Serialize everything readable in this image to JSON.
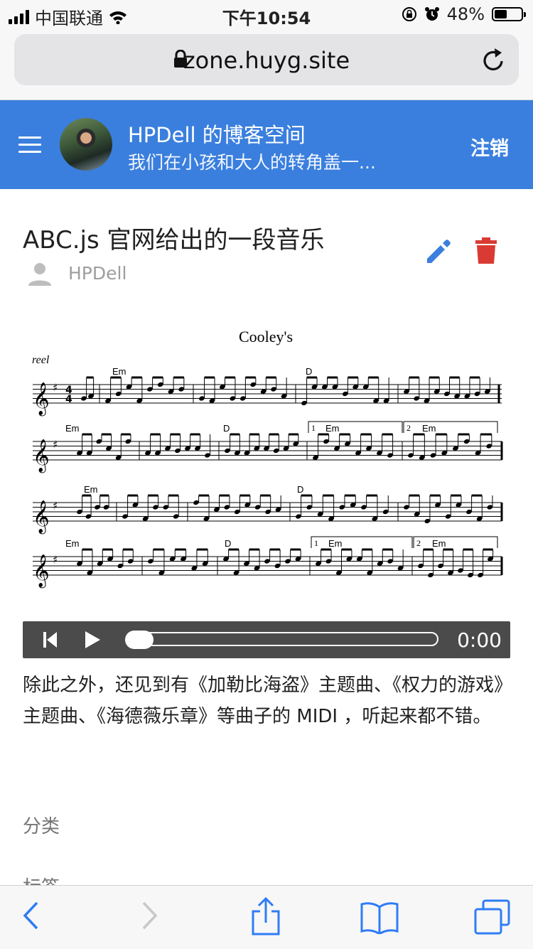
{
  "status": {
    "carrier": "中国联通",
    "time": "下午10:54",
    "battery": "48%",
    "battery_level": 0.48
  },
  "browser": {
    "url": "zone.huyg.site"
  },
  "appbar": {
    "title": "HPDell 的博客空间",
    "subtitle": "我们在小孩和大人的转角盖一...",
    "logout": "注销"
  },
  "post": {
    "title": "ABC.js 官网给出的一段音乐",
    "author": "HPDell"
  },
  "score": {
    "title": "Cooley's",
    "rhythm": "reel",
    "meter_top": "4",
    "meter_bottom": "4",
    "chords": [
      "Em",
      "D",
      "Em",
      "D",
      "Em",
      "Em",
      "Em",
      "D",
      "Em",
      "D",
      "Em",
      "Em"
    ],
    "endings": [
      "1",
      "2",
      "1",
      "2"
    ]
  },
  "player": {
    "time": "0:00",
    "progress": 0
  },
  "content": {
    "paragraph": "除此之外，还见到有《加勒比海盗》主题曲、《权力的游戏》主题曲、《海德薇乐章》等曲子的 MIDI ，听起来都不错。",
    "category_label": "分类",
    "tags_label": "标签"
  },
  "colors": {
    "appbar": "#3a7fde",
    "edit": "#3a7fde",
    "delete": "#d93a33"
  }
}
